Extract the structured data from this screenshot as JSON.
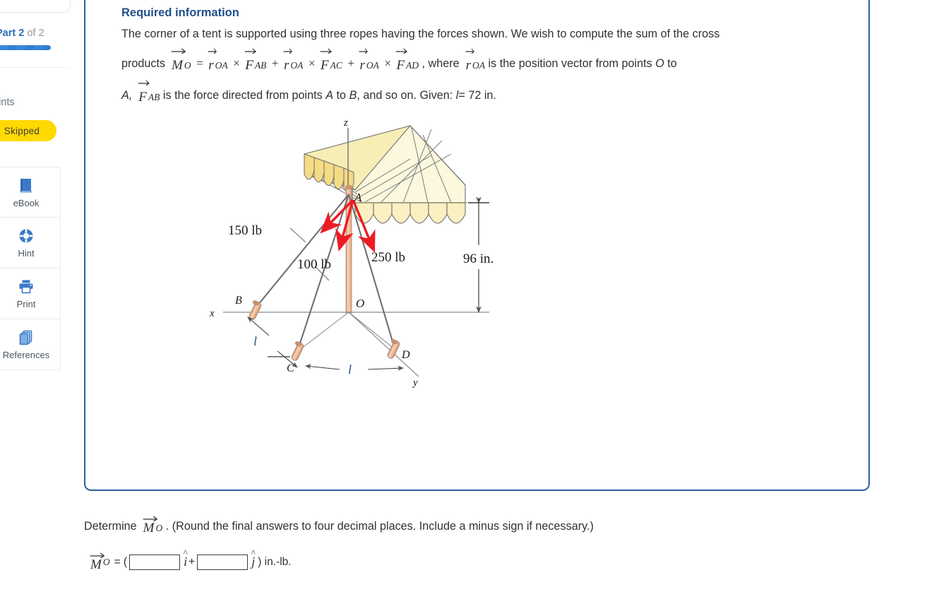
{
  "sidebar": {
    "part_label_prefix": "Part",
    "part_number": "2",
    "part_of": "of 2",
    "points_label": "oints",
    "status_badge": "Skipped",
    "tools": [
      {
        "label": "eBook",
        "icon": "ebook-icon"
      },
      {
        "label": "Hint",
        "icon": "lifering-icon"
      },
      {
        "label": "Print",
        "icon": "printer-icon"
      },
      {
        "label": "References",
        "icon": "copy-pages-icon"
      }
    ]
  },
  "question": {
    "heading": "Required information",
    "line1_a": "The corner of a tent is supported using three ropes having the forces shown. We wish to compute the sum of the cross",
    "line2_products": "products",
    "M": "M",
    "M_sub": "O",
    "equals": "=",
    "r": "r",
    "r_sub": "OA",
    "cross": "×",
    "F": "F",
    "F_sub_AB": "AB",
    "plus": "+",
    "F_sub_AC": "AC",
    "F_sub_AD": "AD",
    "where_text": ", where",
    "tail_1": "is the position vector from points",
    "O_italic": "O",
    "to_text": "to",
    "A_italic": "A,",
    "tail_2": "is the force directed from points",
    "A2": "A",
    "to2": "to",
    "B2": "B",
    "tail_3": ", and so on. Given:",
    "given_l": "l",
    "given_eq": "= 72 in."
  },
  "figure": {
    "axis_z": "z",
    "axis_x": "x",
    "axis_y": "y",
    "point_A": "A",
    "point_B": "B",
    "point_C": "C",
    "point_D": "D",
    "point_O": "O",
    "force_1": "150 lb",
    "force_2": "100 lb",
    "force_3": "250 lb",
    "height_dim": "96 in.",
    "len_dim_1": "l",
    "len_dim_2": "l",
    "colors": {
      "canopy_light": "#fcf7d8",
      "canopy_mid": "#f7ecb0",
      "scallop": "#f6e08a",
      "pole": "#f2a879",
      "arrow_red": "#ee1b24",
      "line_gray": "#6f6f6f"
    }
  },
  "answer": {
    "determine_text": "Determine",
    "M": "M",
    "M_sub": "O",
    "determine_tail": ". (Round the final answers to four decimal places. Include a minus sign if necessary.)",
    "eq_open": "= (",
    "i_hat": "i",
    "plus": "+",
    "j_hat": "j",
    "close_units": ") in.-lb.",
    "input_i_value": "",
    "input_j_value": "",
    "input_placeholder": ""
  }
}
